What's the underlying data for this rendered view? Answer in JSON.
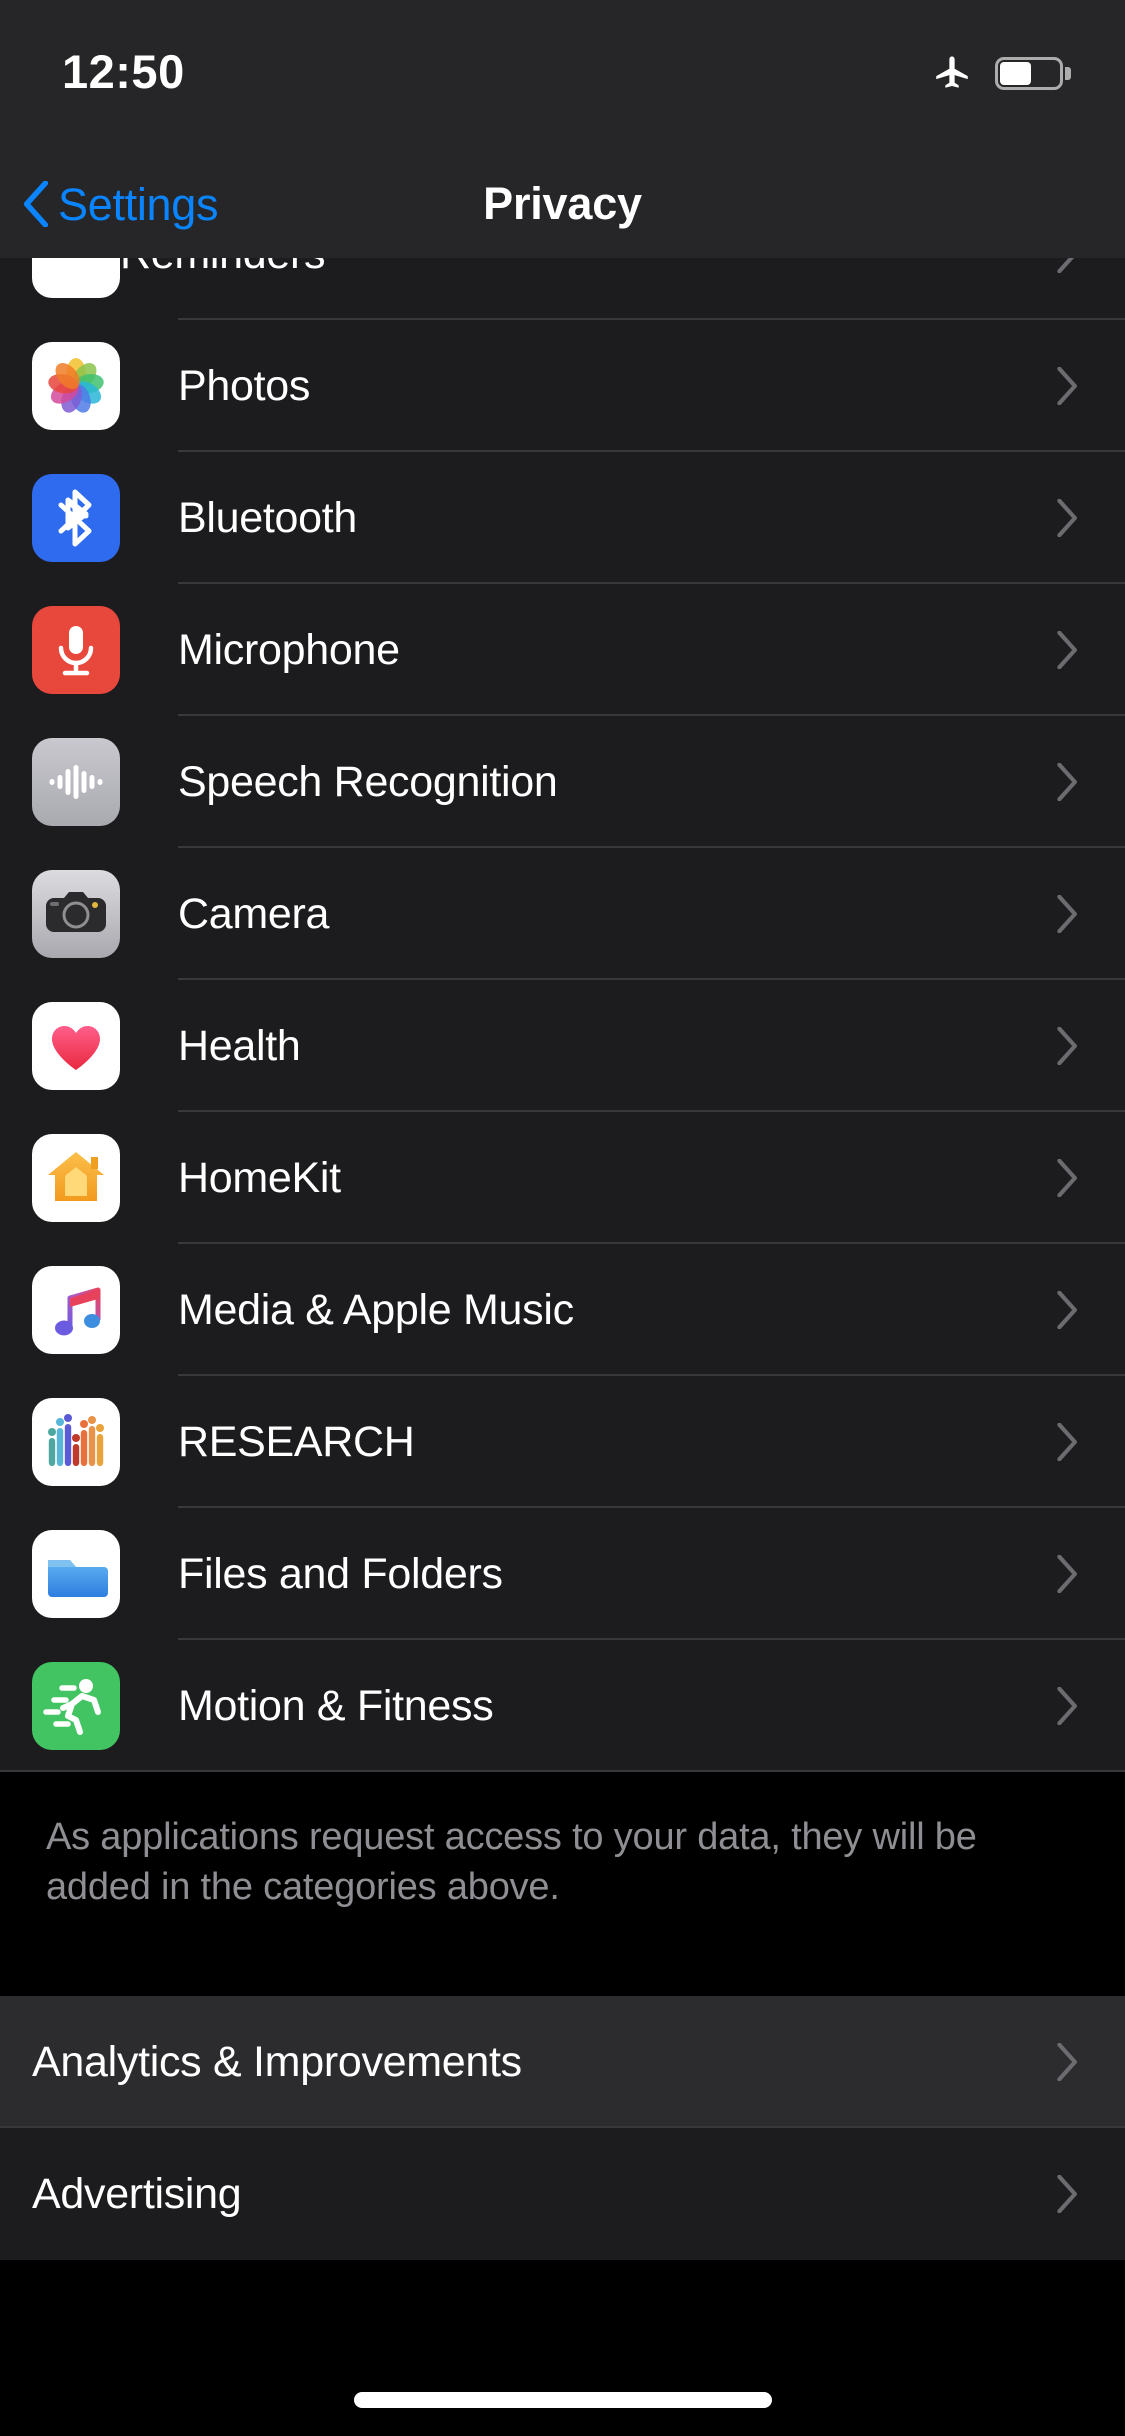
{
  "status_bar": {
    "time": "12:50",
    "airplane_icon": "airplane-icon",
    "battery_icon": "battery-icon",
    "battery_level_percent": 45
  },
  "nav_bar": {
    "back_label": "Settings",
    "back_icon": "chevron-left-icon",
    "title": "Privacy",
    "accent_color": "#0A84FF"
  },
  "main": {
    "partial_row": {
      "label": "Reminders",
      "icon": "reminders-icon"
    },
    "permission_rows": [
      {
        "label": "Photos",
        "icon": "photos-icon",
        "chevron": "chevron-right-icon"
      },
      {
        "label": "Bluetooth",
        "icon": "bluetooth-icon",
        "chevron": "chevron-right-icon"
      },
      {
        "label": "Microphone",
        "icon": "microphone-icon",
        "chevron": "chevron-right-icon"
      },
      {
        "label": "Speech Recognition",
        "icon": "speech-icon",
        "chevron": "chevron-right-icon"
      },
      {
        "label": "Camera",
        "icon": "camera-icon",
        "chevron": "chevron-right-icon"
      },
      {
        "label": "Health",
        "icon": "health-icon",
        "chevron": "chevron-right-icon"
      },
      {
        "label": "HomeKit",
        "icon": "homekit-icon",
        "chevron": "chevron-right-icon"
      },
      {
        "label": "Media & Apple Music",
        "icon": "music-icon",
        "chevron": "chevron-right-icon"
      },
      {
        "label": "RESEARCH",
        "icon": "research-icon",
        "chevron": "chevron-right-icon"
      },
      {
        "label": "Files and Folders",
        "icon": "files-icon",
        "chevron": "chevron-right-icon"
      },
      {
        "label": "Motion & Fitness",
        "icon": "motion-icon",
        "chevron": "chevron-right-icon"
      }
    ],
    "footer_note": "As applications request access to your data, they will be added in the categories above.",
    "bottom_rows": [
      {
        "label": "Analytics & Improvements",
        "chevron": "chevron-right-icon",
        "pressed": true
      },
      {
        "label": "Advertising",
        "chevron": "chevron-right-icon",
        "pressed": false
      }
    ]
  },
  "colors": {
    "background": "#000000",
    "row_background": "#1C1C1E",
    "row_pressed": "#2C2C2E",
    "bar_background": "#262628",
    "separator": "#38383A",
    "primary_text": "#FFFFFF",
    "secondary_text": "#8E8E93",
    "accent": "#0A84FF"
  }
}
